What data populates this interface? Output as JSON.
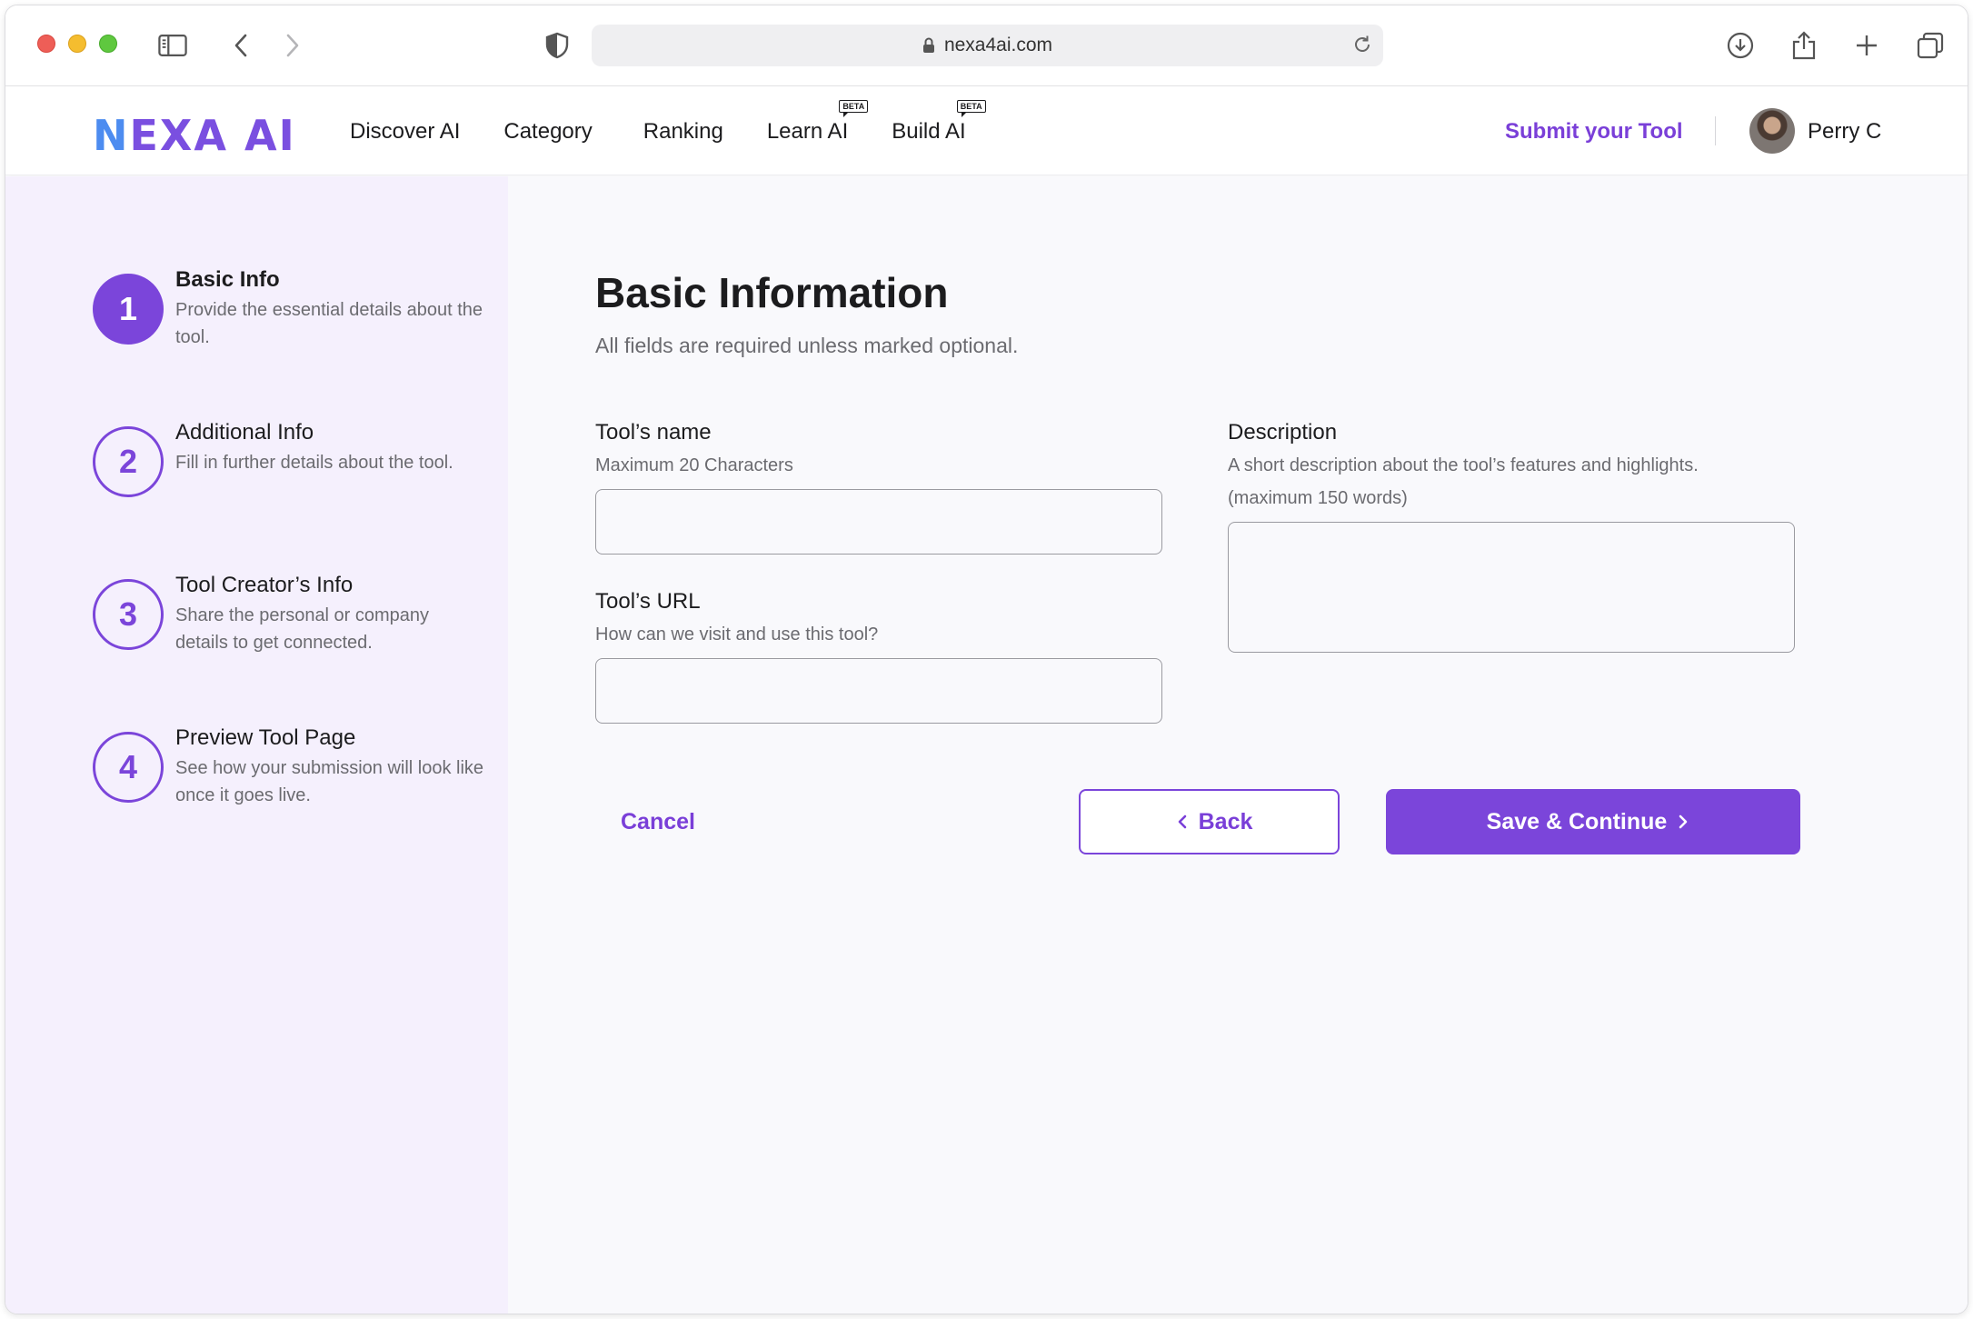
{
  "browser": {
    "url": "nexa4ai.com",
    "icons": [
      "sidebar-icon",
      "back-arrow-icon",
      "forward-arrow-icon",
      "shield-icon",
      "lock-icon",
      "reload-icon",
      "download-icon",
      "share-icon",
      "plus-icon",
      "tabs-icon"
    ]
  },
  "header": {
    "logo_n": "N",
    "logo_rest": "EXA AI",
    "nav": [
      {
        "label": "Discover AI",
        "badge": ""
      },
      {
        "label": "Category",
        "badge": ""
      },
      {
        "label": "Ranking",
        "badge": ""
      },
      {
        "label": "Learn AI",
        "badge": "BETA"
      },
      {
        "label": "Build AI",
        "badge": "BETA"
      }
    ],
    "submit_label": "Submit your Tool",
    "user_name": "Perry C"
  },
  "steps": [
    {
      "number": "1",
      "title": "Basic Info",
      "description": "Provide the essential details about the tool."
    },
    {
      "number": "2",
      "title": "Additional Info",
      "description": "Fill in further details about the tool."
    },
    {
      "number": "3",
      "title": "Tool Creator’s Info",
      "description": "Share the personal or company details to get connected."
    },
    {
      "number": "4",
      "title": "Preview Tool Page",
      "description": "See how your submission will look like once it goes live."
    }
  ],
  "form": {
    "title": "Basic Information",
    "subtitle": "All fields are required unless marked optional.",
    "name": {
      "label": "Tool’s name",
      "hint": "Maximum 20 Characters",
      "value": ""
    },
    "url": {
      "label": "Tool’s URL",
      "hint": "How can we visit and use this tool?",
      "value": ""
    },
    "description": {
      "label": "Description",
      "hint_1": "A short description about the tool’s features and highlights.",
      "hint_2": "(maximum 150 words)",
      "value": ""
    },
    "cancel_label": "Cancel",
    "back_label": "Back",
    "save_label": "Save & Continue"
  },
  "colors": {
    "accent": "#7b45da",
    "sidebar_bg": "#f5f0fd",
    "logo_blue": "#4d8cf0"
  }
}
